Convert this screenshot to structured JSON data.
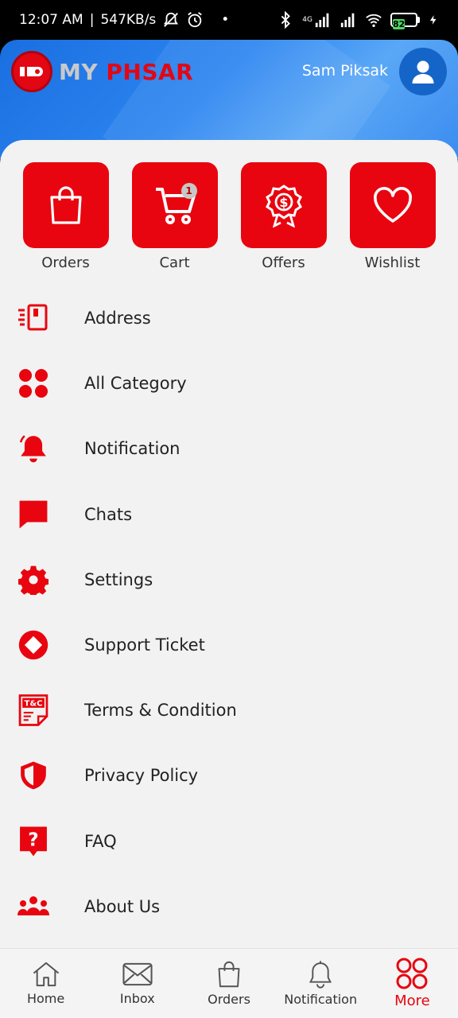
{
  "status_bar": {
    "time": "12:07 AM",
    "speed": "547KB/s",
    "network_label": "4G",
    "battery": "82"
  },
  "header": {
    "brand_my": "MY",
    "brand_phsar": "PHSAR",
    "username": "Sam Piksak"
  },
  "quick_actions": [
    {
      "label": "Orders",
      "icon": "shopping-bag-icon"
    },
    {
      "label": "Cart",
      "icon": "cart-icon",
      "badge": "1"
    },
    {
      "label": "Offers",
      "icon": "offer-badge-icon"
    },
    {
      "label": "Wishlist",
      "icon": "heart-icon"
    }
  ],
  "menu": [
    {
      "label": "Address",
      "icon": "address-icon"
    },
    {
      "label": "All Category",
      "icon": "category-icon"
    },
    {
      "label": "Notification",
      "icon": "bell-icon"
    },
    {
      "label": "Chats",
      "icon": "chat-icon"
    },
    {
      "label": "Settings",
      "icon": "gear-icon"
    },
    {
      "label": "Support Ticket",
      "icon": "support-icon"
    },
    {
      "label": "Terms & Condition",
      "icon": "terms-icon",
      "icon_text": "T&C"
    },
    {
      "label": "Privacy Policy",
      "icon": "shield-icon"
    },
    {
      "label": "FAQ",
      "icon": "faq-icon",
      "icon_text": "?"
    },
    {
      "label": "About Us",
      "icon": "people-icon"
    }
  ],
  "bottom_nav": [
    {
      "label": "Home",
      "icon": "home-icon"
    },
    {
      "label": "Inbox",
      "icon": "mail-icon"
    },
    {
      "label": "Orders",
      "icon": "bag-icon"
    },
    {
      "label": "Notification",
      "icon": "bell-outline-icon"
    },
    {
      "label": "More",
      "icon": "grid-icon",
      "active": true
    }
  ],
  "colors": {
    "accent": "#e8050f",
    "header": "#2c85f0"
  }
}
